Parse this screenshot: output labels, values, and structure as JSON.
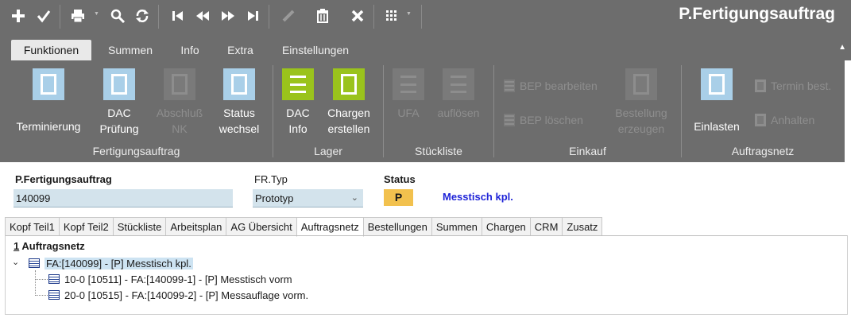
{
  "app": {
    "title": "P.Fertigungsauftrag"
  },
  "toolbar": {
    "icons": [
      "plus-icon",
      "check-icon",
      "printer-icon",
      "search-icon",
      "refresh-icon",
      "first-record-icon",
      "previous-record-icon",
      "next-record-icon",
      "last-record-icon",
      "edit-icon",
      "trash-icon",
      "close-icon",
      "grid-icon"
    ]
  },
  "ribbon_tabs": [
    "Funktionen",
    "Summen",
    "Info",
    "Extra",
    "Einstellungen"
  ],
  "ribbon": {
    "fertigungsauftrag": {
      "label": "Fertigungsauftrag",
      "terminierung": "Terminierung",
      "dac_pruefung_1": "DAC",
      "dac_pruefung_2": "Prüfung",
      "abschluss_1": "Abschluß",
      "abschluss_2": "NK",
      "status_1": "Status",
      "status_2": "wechsel"
    },
    "lager": {
      "label": "Lager",
      "dac_info_1": "DAC",
      "dac_info_2": "Info",
      "chargen_1": "Chargen",
      "chargen_2": "erstellen"
    },
    "stueckliste": {
      "label": "Stückliste",
      "ufa": "UFA",
      "aufloesen": "auflösen"
    },
    "einkauf": {
      "label": "Einkauf",
      "bep_bearbeiten": "BEP bearbeiten",
      "bep_loeschen": "BEP löschen",
      "bestellung_1": "Bestellung",
      "bestellung_2": "erzeugen"
    },
    "auftragsnetz": {
      "label": "Auftragsnetz",
      "einlasten": "Einlasten",
      "termin_best": "Termin best.",
      "anhalten": "Anhalten"
    }
  },
  "header": {
    "fa_label": "P.Fertigungsauftrag",
    "fa_value": "140099",
    "fr_typ_label": "FR.Typ",
    "fr_typ_value": "Prototyp",
    "status_label": "Status",
    "status_value": "P",
    "status_text": "Messtisch kpl."
  },
  "tabs": [
    "Kopf Teil1",
    "Kopf Teil2",
    "Stückliste",
    "Arbeitsplan",
    "AG Übersicht",
    "Auftragsnetz",
    "Bestellungen",
    "Summen",
    "Chargen",
    "CRM",
    "Zusatz"
  ],
  "active_tab": "Auftragsnetz",
  "panel": {
    "title_num": "1",
    "title_text": " Auftragsnetz",
    "tree": [
      "FA:[140099] - [P] Messtisch kpl.",
      "10-0 [10511] - FA:[140099-1] - [P] Messtisch vorm",
      "20-0 [10515] - FA:[140099-2] - [P] Messauflage vorm."
    ]
  },
  "colors": {
    "toolbar_bg": "#6d6d6d",
    "accent_blue": "#a9cfe8",
    "accent_green": "#9ac31c",
    "status_badge": "#f2c14e",
    "status_text": "#1f24d8",
    "field_bg": "#d3e3ec"
  }
}
